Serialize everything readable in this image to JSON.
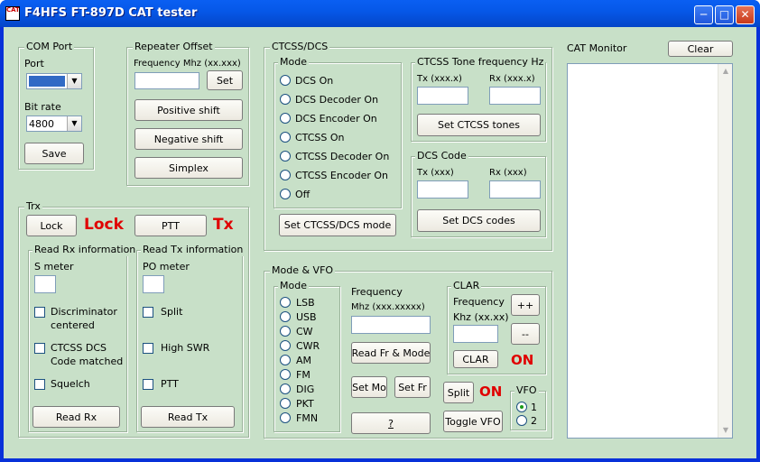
{
  "window": {
    "title": "F4HFS FT-897D CAT tester",
    "icon_text": "CAT"
  },
  "com_port": {
    "title": "COM Port",
    "port_label": "Port",
    "port_value": "",
    "bit_rate_label": "Bit rate",
    "bit_rate_value": "4800",
    "save": "Save"
  },
  "repeater": {
    "title": "Repeater Offset",
    "freq_label": "Frequency Mhz (xx.xxx)",
    "set": "Set",
    "positive": "Positive shift",
    "negative": "Negative shift",
    "simplex": "Simplex"
  },
  "ctcss_dcs": {
    "title": "CTCSS/DCS",
    "mode_title": "Mode",
    "modes": [
      "DCS On",
      "DCS Decoder On",
      "DCS Encoder On",
      "CTCSS On",
      "CTCSS Decoder On",
      "CTCSS Encoder On",
      "Off"
    ],
    "set_mode": "Set CTCSS/DCS mode",
    "tone_title": "CTCSS Tone frequency Hz",
    "tone_tx": "Tx (xxx.x)",
    "tone_rx": "Rx (xxx.x)",
    "set_tones": "Set CTCSS tones",
    "dcs_title": "DCS Code",
    "dcs_tx": "Tx (xxx)",
    "dcs_rx": "Rx (xxx)",
    "set_dcs": "Set DCS codes"
  },
  "trx": {
    "title": "Trx",
    "lock": "Lock",
    "lock_status": "Lock",
    "ptt": "PTT",
    "tx_status": "Tx",
    "rx_info": {
      "title": "Read Rx information",
      "s_meter": "S meter",
      "discriminator": "Discriminator centered",
      "ctcss_match": "CTCSS DCS Code matched",
      "squelch": "Squelch",
      "read": "Read Rx"
    },
    "tx_info": {
      "title": "Read Tx information",
      "po_meter": "PO meter",
      "split": "Split",
      "high_swr": "High SWR",
      "ptt": "PTT",
      "read": "Read Tx"
    }
  },
  "mode_vfo": {
    "title": "Mode & VFO",
    "mode_title": "Mode",
    "modes": [
      "LSB",
      "USB",
      "CW",
      "CWR",
      "AM",
      "FM",
      "DIG",
      "PKT",
      "FMN"
    ],
    "frequency_label": "Frequency",
    "frequency_unit": "Mhz (xxx.xxxxx)",
    "read_fr_mode": "Read Fr & Mode",
    "set_mo": "Set Mo",
    "set_fr": "Set Fr",
    "help": "?",
    "clar": {
      "title": "CLAR",
      "freq_label": "Frequency",
      "freq_unit": "Khz (xx.xx)",
      "plus": "++",
      "minus": "--",
      "clar_button": "CLAR",
      "status": "ON"
    },
    "split": "Split",
    "split_status": "ON",
    "toggle_vfo": "Toggle VFO",
    "vfo_title": "VFO",
    "vfo_options": [
      "1",
      "2"
    ],
    "vfo_selected": "1"
  },
  "cat_monitor": {
    "title": "CAT Monitor",
    "clear": "Clear"
  },
  "colors": {
    "status_red": "#e00000",
    "client_bg": "#c8e0c8",
    "titlebar_blue": "#0658e8"
  }
}
